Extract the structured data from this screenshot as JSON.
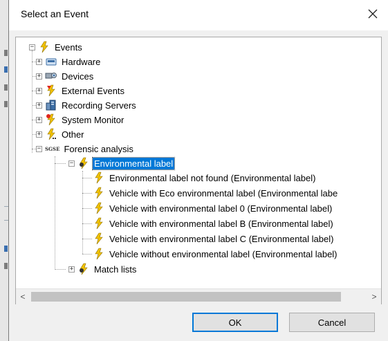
{
  "dialog": {
    "title": "Select an Event",
    "ok_label": "OK",
    "cancel_label": "Cancel"
  },
  "tree": {
    "root": {
      "label": "Events",
      "icon": "lightning-icon"
    },
    "categories": [
      {
        "label": "Hardware",
        "icon": "hardware-icon"
      },
      {
        "label": "Devices",
        "icon": "devices-icon"
      },
      {
        "label": "External Events",
        "icon": "external-event-icon"
      },
      {
        "label": "Recording Servers",
        "icon": "recording-server-icon"
      },
      {
        "label": "System Monitor",
        "icon": "system-monitor-icon"
      },
      {
        "label": "Other",
        "icon": "other-event-icon"
      }
    ],
    "forensic": {
      "label": "Forensic analysis",
      "badge": "SGSE",
      "selected": {
        "label": "Environmental label"
      },
      "events": [
        "Environmental label not found (Environmental label)",
        "Vehicle with Eco environmental label (Environmental labe",
        "Vehicle with environmental label 0 (Environmental label)",
        "Vehicle with environmental label B (Environmental label)",
        "Vehicle with environmental label C (Environmental label)",
        "Vehicle without environmental label (Environmental label)"
      ],
      "match_lists": {
        "label": "Match lists"
      }
    }
  },
  "colors": {
    "selection": "#0078d7",
    "lightning": "#f2c200",
    "accent_red": "#e0261b"
  }
}
